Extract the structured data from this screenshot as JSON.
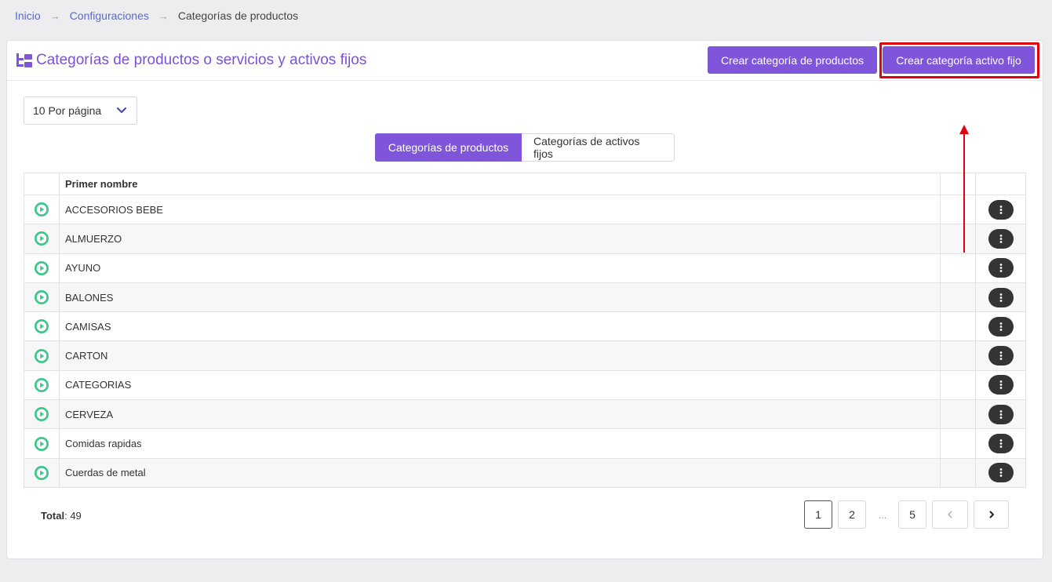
{
  "breadcrumb": {
    "home": "Inicio",
    "settings": "Configuraciones",
    "separator": "→",
    "current": "Categorías de productos"
  },
  "header": {
    "title": "Categorías de productos o servicios y activos fijos",
    "title_icon": "category-tree-icon",
    "create_product_label": "Crear categoría de productos",
    "create_asset_label": "Crear categoría activo fijo"
  },
  "per_page": {
    "value": "10 Por página"
  },
  "tabs": [
    {
      "label": "Categorías de productos",
      "active": true
    },
    {
      "label": "Categorías de activos fijos",
      "active": false
    }
  ],
  "table": {
    "columns": [
      "",
      "Primer nombre",
      "",
      ""
    ],
    "rows": [
      {
        "name": "ACCESORIOS BEBE"
      },
      {
        "name": "ALMUERZO"
      },
      {
        "name": "AYUNO"
      },
      {
        "name": "BALONES"
      },
      {
        "name": "CAMISAS"
      },
      {
        "name": "CARTON"
      },
      {
        "name": "CATEGORIAS"
      },
      {
        "name": "CERVEZA"
      },
      {
        "name": "Comidas rapidas"
      },
      {
        "name": "Cuerdas de metal"
      }
    ]
  },
  "footer": {
    "total_label": "Total",
    "total_value": ": 49"
  },
  "pagination": {
    "pages": [
      "1",
      "2",
      "5"
    ],
    "ellipsis": "...",
    "current": "1"
  },
  "colors": {
    "accent": "#7f56d9",
    "highlight": "#e0000e",
    "play_icon": "#3cc68a"
  }
}
